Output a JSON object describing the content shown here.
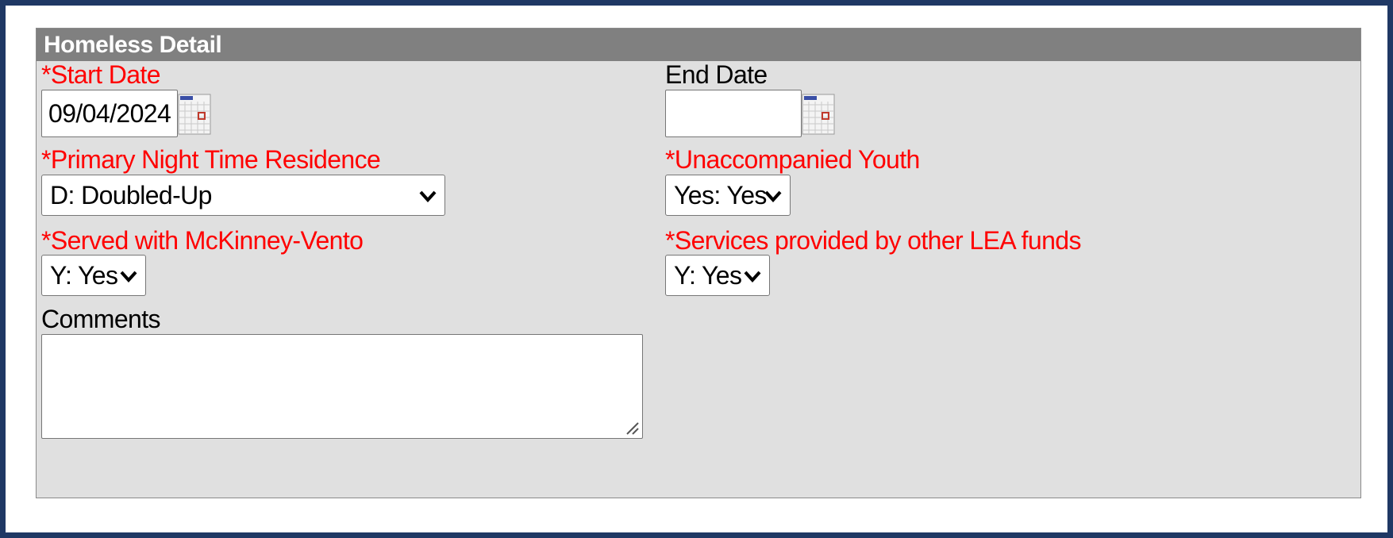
{
  "panel": {
    "title": "Homeless Detail"
  },
  "fields": {
    "start_date": {
      "label": "*Start Date",
      "value": "09/04/2024"
    },
    "end_date": {
      "label": "End Date",
      "value": ""
    },
    "primary_residence": {
      "label": "*Primary Night Time Residence",
      "value": "D: Doubled-Up"
    },
    "unaccompanied_youth": {
      "label": "*Unaccompanied Youth",
      "value": "Yes: Yes"
    },
    "served_mckinney": {
      "label": "*Served with McKinney-Vento",
      "value": "Y: Yes"
    },
    "services_lea": {
      "label": "*Services provided by other LEA funds",
      "value": "Y: Yes"
    },
    "comments": {
      "label": "Comments",
      "value": ""
    }
  },
  "icons": {
    "calendar": "calendar-icon",
    "dropdown": "chevron-down-icon",
    "resize": "resize-grip-icon"
  },
  "colors": {
    "frame_border": "#1f3864",
    "header_bg": "#808080",
    "panel_bg": "#e0e0e0",
    "required_label": "#ff0000"
  }
}
